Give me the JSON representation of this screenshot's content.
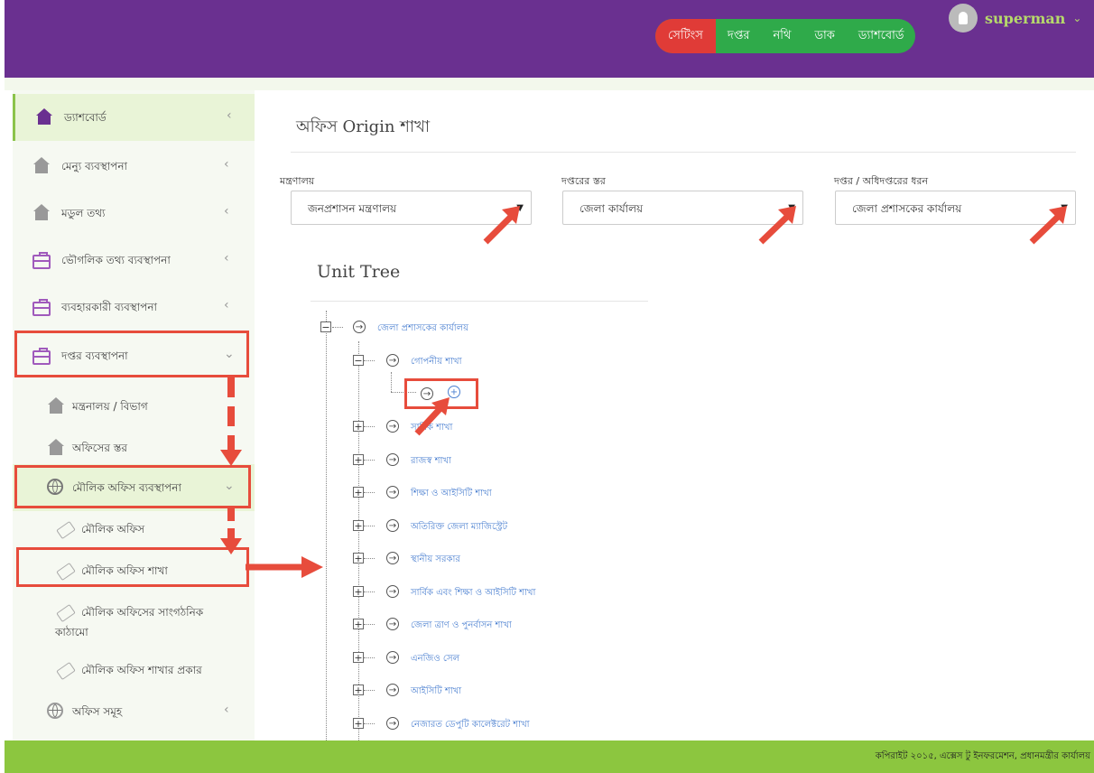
{
  "header": {
    "nav": [
      "সেটিংস",
      "দপ্তর",
      "নথি",
      "ডাক",
      "ড্যাশবোর্ড"
    ],
    "username": "superman"
  },
  "sidebar": {
    "items": [
      {
        "label": "ড্যাশবোর্ড",
        "icon": "home-icon"
      },
      {
        "label": "মেন্যু ব্যবস্থাপনা",
        "icon": "home-icon"
      },
      {
        "label": "মডুল তথ্য",
        "icon": "home-icon"
      },
      {
        "label": "ভৌগলিক তথ্য ব্যবস্থাপনা",
        "icon": "briefcase-icon"
      },
      {
        "label": "ব্যবহারকারী ব্যবস্থাপনা",
        "icon": "briefcase-icon"
      },
      {
        "label": "দপ্তর ব্যবস্থাপনা",
        "icon": "briefcase-icon"
      },
      {
        "label": "মন্ত্রনালয় / বিভাগ",
        "icon": "home-icon"
      },
      {
        "label": "অফিসের স্তর",
        "icon": "home-icon"
      },
      {
        "label": "মৌলিক অফিস ব্যবস্থাপনা",
        "icon": "globe-icon"
      },
      {
        "label": "মৌলিক অফিস",
        "icon": "tag-icon"
      },
      {
        "label": "মৌলিক অফিস শাখা",
        "icon": "tag-icon"
      },
      {
        "label": "মৌলিক অফিসের সাংগঠনিক",
        "label2": "কাঠামো",
        "icon": "tag-icon"
      },
      {
        "label": "মৌলিক অফিস শাখার প্রকার",
        "icon": "tag-icon"
      },
      {
        "label": "অফিস সমূহ",
        "icon": "globe-icon"
      }
    ]
  },
  "main": {
    "title": "অফিস Origin শাখা",
    "filters": [
      {
        "label": "মন্ত্রণালয়",
        "value": "জনপ্রশাসন মন্ত্রণালয়"
      },
      {
        "label": "দপ্তরের স্তর",
        "value": "জেলা কার্যালয়"
      },
      {
        "label": "দপ্তর / অধিদপ্তরের ধরন",
        "value": "জেলা প্রশাসকের কার্যালয়"
      }
    ],
    "unit_tree_title": "Unit Tree",
    "tree": {
      "root": "জেলা প্রশাসকের কার্যালয়",
      "expanded": "গোপনীয় শাখা",
      "children": [
        "সার্বিক শাখা",
        "রাজস্ব শাখা",
        "শিক্ষা ও আইসিটি শাখা",
        "অতিরিক্ত জেলা ম্যাজিস্ট্রেট",
        "স্থানীয় সরকার",
        "সার্বিক এবং শিক্ষা ও আইসিটি শাখা",
        "জেলা ত্রাণ ও পুনর্বাসন শাখা",
        "এনজিও সেল",
        "আইসিটি শাখা",
        "নেজারত ডেপুটি কালেক্টরেট শাখা"
      ]
    }
  },
  "footer": {
    "text": "কপিরাইট ২০১৫, এক্সেস টু ইনফরমেশন, প্রধানমন্ত্রীর কার্যালয়"
  },
  "colors": {
    "header": "#6a3090",
    "nav_green": "#2faa4a",
    "nav_red": "#e03b37",
    "footer": "#8cc63f",
    "annotation": "#e74c3c",
    "link": "#4a7fd0"
  }
}
